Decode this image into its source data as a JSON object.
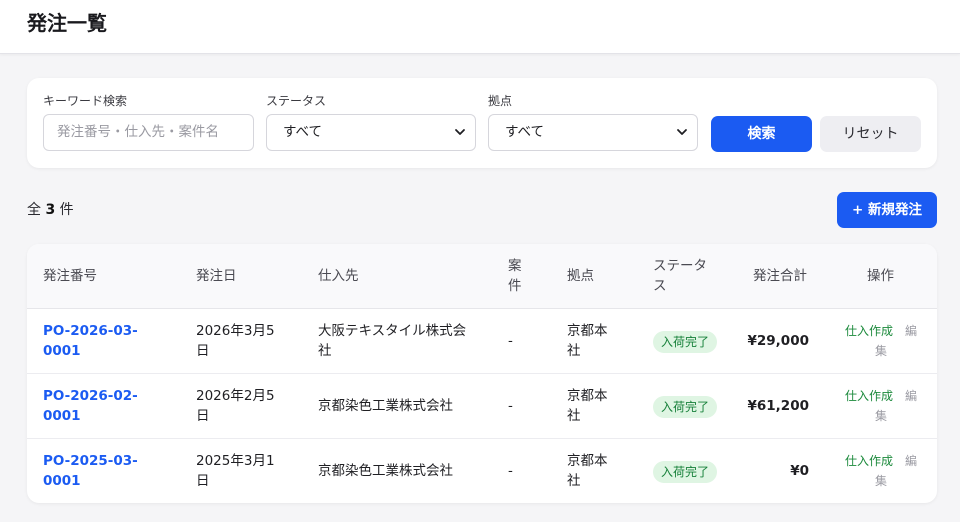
{
  "page": {
    "title": "発注一覧"
  },
  "filters": {
    "keyword": {
      "label": "キーワード検索",
      "placeholder": "発注番号・仕入先・案件名",
      "value": ""
    },
    "status": {
      "label": "ステータス",
      "selected": "すべて"
    },
    "location": {
      "label": "拠点",
      "selected": "すべて"
    },
    "search_label": "検索",
    "reset_label": "リセット"
  },
  "summary": {
    "prefix": "全",
    "count": "3",
    "suffix": "件"
  },
  "new_order_label": "+ 新規発注",
  "table": {
    "headers": {
      "po_number": "発注番号",
      "order_date": "発注日",
      "supplier": "仕入先",
      "project_1": "案",
      "project_2": "件",
      "location": "拠点",
      "status_1": "ステータ",
      "status_2": "ス",
      "total": "発注合計",
      "actions": "操作"
    },
    "rows": [
      {
        "po_1": "PO-2026-03-",
        "po_2": "0001",
        "date_1": "2026年3月5",
        "date_2": "日",
        "supplier_1": "大阪テキスタイル株式会",
        "supplier_2": "社",
        "project": "-",
        "loc_1": "京都本",
        "loc_2": "社",
        "status": "入荷完了",
        "total": "¥29,000",
        "action_create": "仕入作成",
        "action_edit_1": "編",
        "action_edit_2": "集"
      },
      {
        "po_1": "PO-2026-02-",
        "po_2": "0001",
        "date_1": "2026年2月5",
        "date_2": "日",
        "supplier_1": "京都染色工業株式会社",
        "supplier_2": "",
        "project": "-",
        "loc_1": "京都本",
        "loc_2": "社",
        "status": "入荷完了",
        "total": "¥61,200",
        "action_create": "仕入作成",
        "action_edit_1": "編",
        "action_edit_2": "集"
      },
      {
        "po_1": "PO-2025-03-",
        "po_2": "0001",
        "date_1": "2025年3月1",
        "date_2": "日",
        "supplier_1": "京都染色工業株式会社",
        "supplier_2": "",
        "project": "-",
        "loc_1": "京都本",
        "loc_2": "社",
        "status": "入荷完了",
        "total": "¥0",
        "action_create": "仕入作成",
        "action_edit_1": "編",
        "action_edit_2": "集"
      }
    ]
  },
  "colors": {
    "primary": "#1b5bf2",
    "status_bg": "#dff5e3",
    "status_text": "#17813a",
    "action_create": "#1c8a3c"
  },
  "icons": {
    "select_arrow": "chevron-down-icon"
  }
}
